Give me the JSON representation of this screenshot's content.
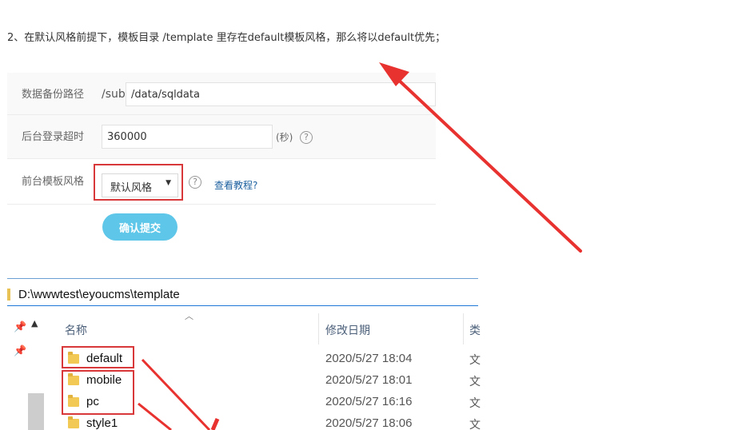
{
  "instruction": "2、在默认风格前提下，模板目录 /template 里存在default模板风格，那么将以default优先；",
  "form": {
    "backup_path": {
      "label": "数据备份路径",
      "prefix": "/sub",
      "value": "/data/sqldata"
    },
    "login_timeout": {
      "label": "后台登录超时",
      "value": "360000",
      "unit": "(秒)"
    },
    "template_style": {
      "label": "前台模板风格",
      "selected": "默认风格",
      "tutorial_link": "查看教程?"
    },
    "submit_label": "确认提交"
  },
  "explorer": {
    "address": "D:\\wwwtest\\eyoucms\\template",
    "columns": {
      "name": "名称",
      "modified": "修改日期",
      "type": "类"
    },
    "files": [
      {
        "name": "default",
        "modified": "2020/5/27 18:04",
        "type": "文"
      },
      {
        "name": "mobile",
        "modified": "2020/5/27 18:01",
        "type": "文"
      },
      {
        "name": "pc",
        "modified": "2020/5/27 16:16",
        "type": "文"
      },
      {
        "name": "style1",
        "modified": "2020/5/27 18:06",
        "type": "文"
      }
    ]
  },
  "icons": {
    "help": "question-circle-icon",
    "pin": "pin-icon",
    "folder": "folder-icon",
    "dropdown": "chevron-down-icon"
  },
  "colors": {
    "highlight_red": "#d9383b",
    "submit_button": "#5ec6e8",
    "link": "#1a5e9e",
    "folder": "#f2c955"
  }
}
